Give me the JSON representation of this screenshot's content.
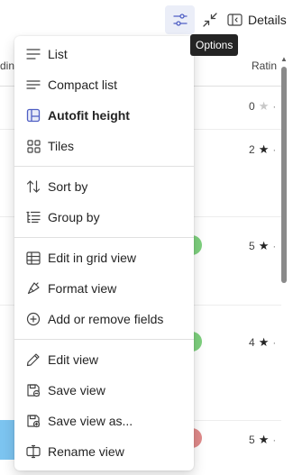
{
  "toolbar": {
    "details_label": "Details",
    "tooltip": "Options"
  },
  "list": {
    "header_left": "ding",
    "header_right": "Ratin",
    "rows": [
      {
        "rating": "0",
        "star": "empty"
      },
      {
        "rating": "2",
        "star": "filled"
      },
      {
        "rating": "5",
        "star": "filled",
        "dot_color": "#7ed07e"
      },
      {
        "rating": "4",
        "star": "filled",
        "dot_color": "#7ed07e"
      },
      {
        "rating": "5",
        "star": "filled",
        "dot_color": "#e08a8a"
      }
    ]
  },
  "menu": {
    "items": [
      {
        "label": "List",
        "icon": "list-icon"
      },
      {
        "label": "Compact list",
        "icon": "compact-list-icon"
      },
      {
        "label": "Autofit height",
        "icon": "autofit-height-icon",
        "active": true
      },
      {
        "label": "Tiles",
        "icon": "tiles-icon"
      },
      {
        "label": "Sort by",
        "icon": "sort-icon"
      },
      {
        "label": "Group by",
        "icon": "group-icon"
      },
      {
        "label": "Edit in grid view",
        "icon": "grid-icon"
      },
      {
        "label": "Format view",
        "icon": "paintbrush-icon"
      },
      {
        "label": "Add or remove fields",
        "icon": "add-circle-icon"
      },
      {
        "label": "Edit view",
        "icon": "pencil-icon"
      },
      {
        "label": "Save view",
        "icon": "save-icon"
      },
      {
        "label": "Save view as...",
        "icon": "save-as-icon"
      },
      {
        "label": "Rename view",
        "icon": "rename-icon"
      }
    ]
  },
  "colors": {
    "accent": "#4f5fc4",
    "options_bg": "#ebeef8"
  }
}
